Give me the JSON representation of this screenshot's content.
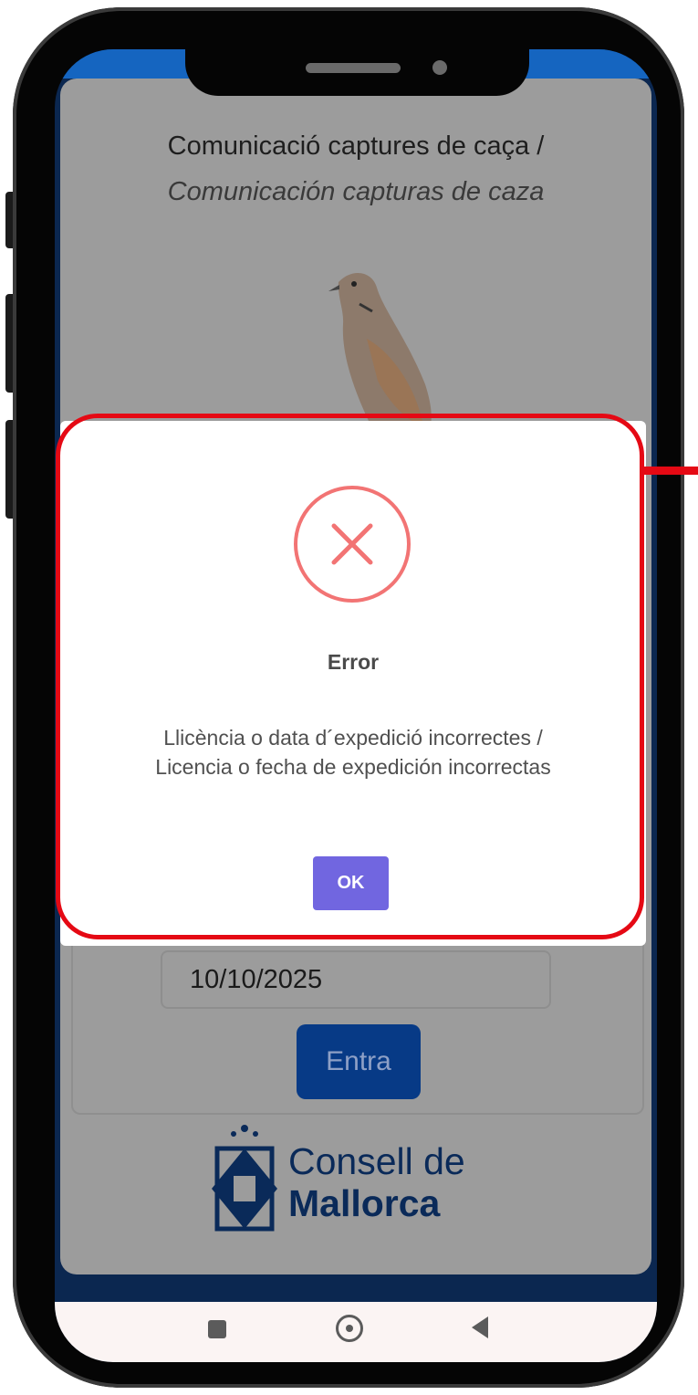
{
  "app": {
    "title_ca": "Comunicació captures de caça /",
    "title_es": "Comunicación capturas de caza"
  },
  "form": {
    "date_value": "10/10/2025",
    "enter_label": "Entra"
  },
  "footer": {
    "logo_line1": "Consell de",
    "logo_line2": "Mallorca"
  },
  "dialog": {
    "icon": "error-x-icon",
    "title": "Error",
    "message": "Llicència o data d´expedició incorrectes / Licencia o fecha de expedición incorrectas",
    "ok_label": "OK"
  },
  "colors": {
    "highlight": "#e50914",
    "ok_button": "#7166e0",
    "error_icon": "#f27474",
    "enter_button": "#073a86"
  }
}
